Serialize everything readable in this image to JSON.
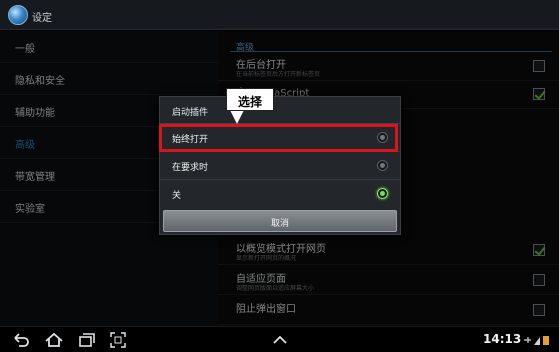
{
  "titlebar": {
    "title": "设定"
  },
  "nav": {
    "items": [
      {
        "label": "一般"
      },
      {
        "label": "隐私和安全"
      },
      {
        "label": "辅助功能"
      },
      {
        "label": "高级"
      },
      {
        "label": "带宽管理"
      },
      {
        "label": "实验室"
      }
    ],
    "active_index": 3
  },
  "content": {
    "section_header": "高级",
    "settings": [
      {
        "title": "在后台打开",
        "subtitle": "在当前标签页后方打开新标签页",
        "checked": false
      },
      {
        "title": "启用 JavaScript",
        "subtitle": "",
        "checked": true
      },
      {
        "title": "以概览模式打开网页",
        "subtitle": "显示新打开网页的概况",
        "checked": true
      },
      {
        "title": "自适应页面",
        "subtitle": "调整网页版面以适应屏幕大小",
        "checked": false
      },
      {
        "title": "阻止弹出窗口",
        "subtitle": "",
        "checked": false
      }
    ]
  },
  "dialog": {
    "title": "启动插件",
    "options": [
      {
        "label": "始终打开",
        "selected": false
      },
      {
        "label": "在要求时",
        "selected": false
      },
      {
        "label": "关",
        "selected": true
      }
    ],
    "cancel_label": "取消"
  },
  "annotation": {
    "label": "选择"
  },
  "sysbar": {
    "time": "14:13",
    "icons": [
      "back-icon",
      "home-icon",
      "recent-apps-icon",
      "screenshot-icon",
      "up-arrow-icon"
    ]
  },
  "colors": {
    "accent": "#2a8fd4",
    "highlight": "#d8141c",
    "check": "#6bd43a"
  }
}
